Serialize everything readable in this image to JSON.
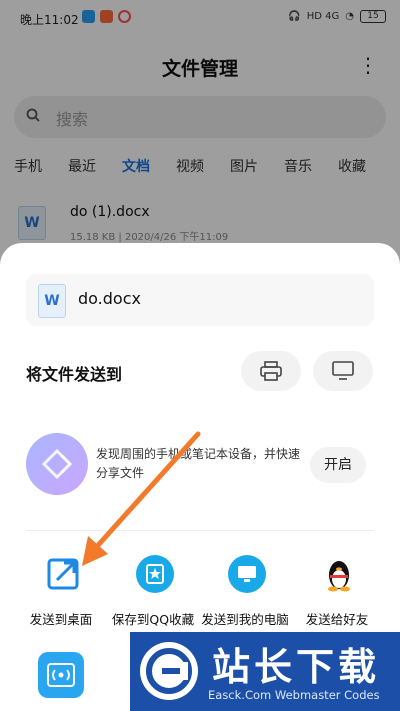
{
  "status_bar": {
    "time": "晚上11:02",
    "battery": "15",
    "indicators": "HD 4G"
  },
  "header": {
    "title": "文件管理",
    "more_icon": "more-vert-icon"
  },
  "search": {
    "placeholder": "搜索"
  },
  "tabs": [
    {
      "label": "手机",
      "active": false
    },
    {
      "label": "最近",
      "active": false
    },
    {
      "label": "文档",
      "active": true
    },
    {
      "label": "视频",
      "active": false
    },
    {
      "label": "图片",
      "active": false
    },
    {
      "label": "音乐",
      "active": false
    },
    {
      "label": "收藏",
      "active": false
    }
  ],
  "file_list": [
    {
      "name": "do (1).docx",
      "meta": "15.18 KB | 2020/4/26 下午11:09",
      "icon": "W"
    }
  ],
  "sheet": {
    "file_name": "do.docx",
    "file_icon": "W",
    "send_title": "将文件发送到",
    "nearby_text": "发现周围的手机或笔记本设备，并快速分享文件",
    "open_button": "开启",
    "share_targets": [
      {
        "label": "发送到桌面",
        "icon": "shortcut-icon",
        "color": "#ffffff"
      },
      {
        "label": "保存到QQ收藏",
        "icon": "qq-favorite-icon",
        "color": "#19a9e8"
      },
      {
        "label": "发送到我的电脑",
        "icon": "computer-icon",
        "color": "#19a9e8"
      },
      {
        "label": "发送给好友",
        "icon": "qq-penguin-icon",
        "color": "#111111"
      }
    ]
  },
  "watermark": {
    "title": "站长下载",
    "subtitle": "Easck.Com Webmaster Codes"
  },
  "colors": {
    "accent": "#1a73e8",
    "arrow": "#f27a2a",
    "watermark_bg": "#1c4fa8"
  }
}
